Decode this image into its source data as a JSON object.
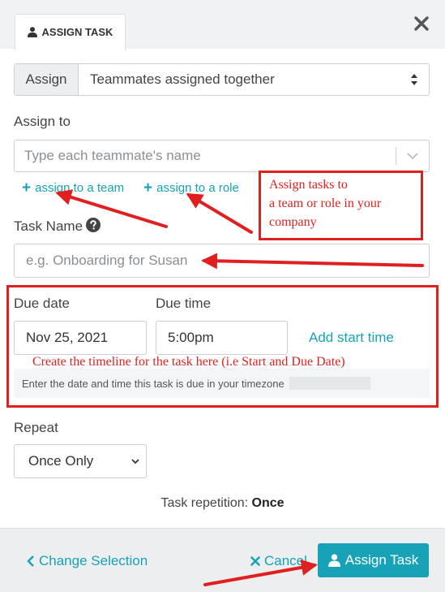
{
  "tab": {
    "label": "ASSIGN TASK"
  },
  "assign_select": {
    "addon": "Assign",
    "value": "Teammates assigned together"
  },
  "assign_to": {
    "label": "Assign to",
    "placeholder": "Type each teammate's name",
    "link_team": "assign to a team",
    "link_role": "assign to a role"
  },
  "task_name": {
    "label": "Task Name",
    "placeholder": "e.g. Onboarding for Susan"
  },
  "due": {
    "date_label": "Due date",
    "time_label": "Due time",
    "date_value": "Nov 25, 2021",
    "time_value": "5:00pm",
    "add_start": "Add start time",
    "hint": "Enter the date and time this task is due in your timezone"
  },
  "repeat": {
    "label": "Repeat",
    "value": "Once Only"
  },
  "repetition": {
    "prefix": "Task repetition:",
    "value": "Once"
  },
  "footer": {
    "change_selection": "Change Selection",
    "cancel": "Cancel",
    "assign_task": "Assign Task"
  },
  "annotations": {
    "callout_line1": "Assign tasks to",
    "callout_line2": "a team or role in your",
    "callout_line3": "company",
    "timeline_note": "Create the timeline for the task here (i.e Start and Due Date)"
  },
  "colors": {
    "accent": "#17a2b8",
    "annotation": "#e02020"
  }
}
